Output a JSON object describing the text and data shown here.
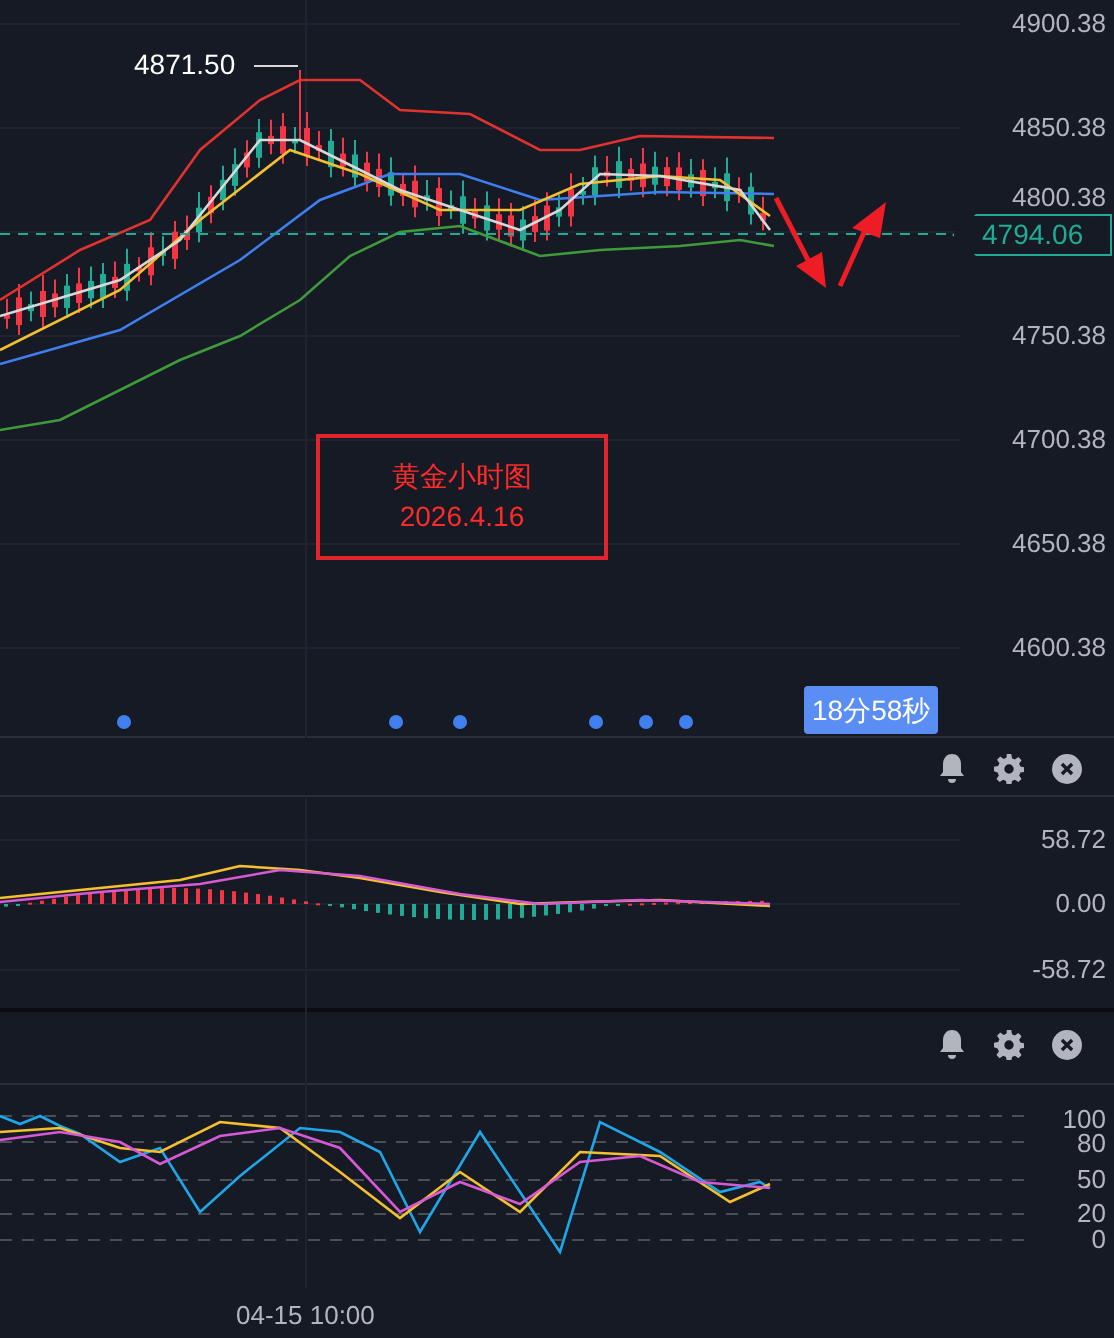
{
  "main_chart": {
    "price_axis": [
      "4900.38",
      "4850.38",
      "4800.38",
      "4750.38",
      "4700.38",
      "4650.38",
      "4600.38"
    ],
    "high_marker": "4871.50",
    "current_price": "4794.06",
    "annotation": {
      "title": "黄金小时图",
      "date": "2026.4.16"
    },
    "countdown": "18分58秒"
  },
  "macd_pane": {
    "axis": [
      "58.72",
      "0.00",
      "-58.72"
    ]
  },
  "kdj_pane": {
    "axis": [
      "100",
      "80",
      "50",
      "20",
      "0"
    ]
  },
  "time_axis": [
    "04-15 10:00"
  ]
}
